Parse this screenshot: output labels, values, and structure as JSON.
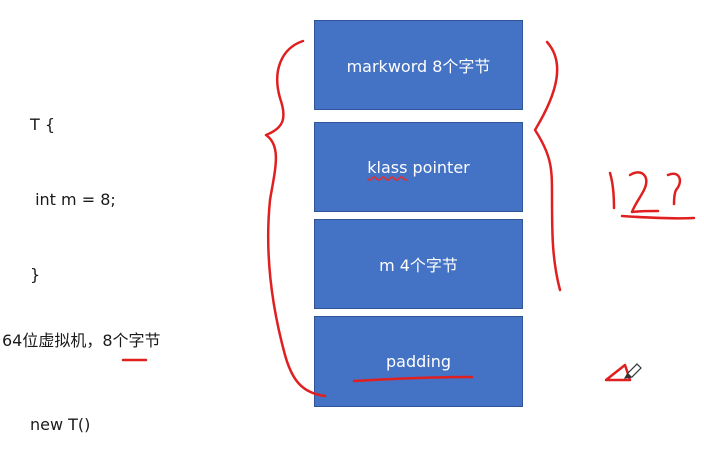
{
  "code": {
    "lines": [
      "T {",
      " int m = 8;",
      "}",
      "",
      "new T()"
    ]
  },
  "note": {
    "text": "64位虚拟机，8个字节"
  },
  "blocks": {
    "markword": "markword 8个字节",
    "klass_word": "klass",
    "klass_rest": " pointer",
    "m": "m 4个字节",
    "padding": "padding"
  },
  "annotation": {
    "handwritten_total": "12?"
  },
  "colors": {
    "block_fill": "#4472c4",
    "block_text": "#ffffff",
    "ink": "#e02020"
  },
  "icons": {
    "cursor": "pen-cursor-icon"
  }
}
